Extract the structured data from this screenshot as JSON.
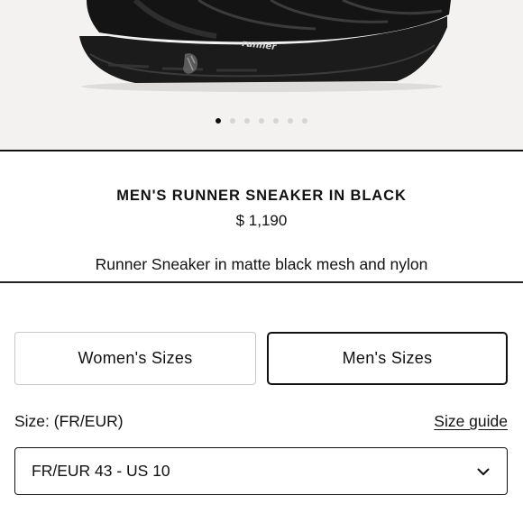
{
  "product": {
    "title": "MEN'S RUNNER SNEAKER IN BLACK",
    "price": "$ 1,190",
    "description": "Runner Sneaker in matte black mesh and nylon",
    "shoe_logo_text": "runner"
  },
  "gallery": {
    "dot_count": 7,
    "active_index": 0
  },
  "sizes": {
    "women_label": "Women's Sizes",
    "men_label": "Men's Sizes",
    "selected_tab": "men",
    "size_label": "Size: (FR/EUR)",
    "size_guide_label": "Size guide",
    "selected_size": "FR/EUR 43 - US 10"
  },
  "icons": {
    "dropdown": "chevron-down-icon"
  },
  "colors": {
    "hero_background": "#f3f2f1",
    "text": "#111111",
    "border_selected": "#111111",
    "border_default": "#c8c8c8"
  }
}
